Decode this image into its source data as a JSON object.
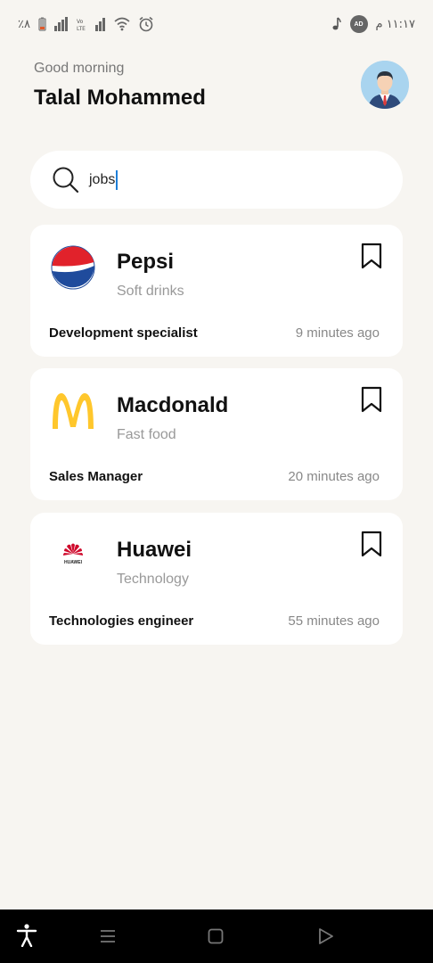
{
  "status_bar": {
    "battery_text": "٪٨",
    "volte_label": "Vo LTE",
    "ad_badge_label": "AD",
    "time": "١١:١٧ م"
  },
  "header": {
    "greeting": "Good morning",
    "user_name": "Talal Mohammed"
  },
  "search": {
    "value": "jobs"
  },
  "jobs": [
    {
      "company": "Pepsi",
      "category": "Soft drinks",
      "title": "Development specialist",
      "time": "9 minutes ago",
      "logo": "pepsi-logo"
    },
    {
      "company": "Macdonald",
      "category": "Fast food",
      "title": "Sales Manager",
      "time": "20 minutes ago",
      "logo": "mcdonalds-logo"
    },
    {
      "company": "Huawei",
      "category": "Technology",
      "title": "Technologies engineer",
      "time": "55 minutes ago",
      "logo": "huawei-logo",
      "logo_text": "HUAWEI"
    }
  ],
  "colors": {
    "background": "#f7f5f1",
    "card": "#ffffff",
    "caret": "#1e7fd8",
    "pepsi_red": "#e1222b",
    "pepsi_blue": "#1f4b9c",
    "mcd_yellow": "#ffc72c",
    "huawei_red": "#cf0a2c"
  }
}
